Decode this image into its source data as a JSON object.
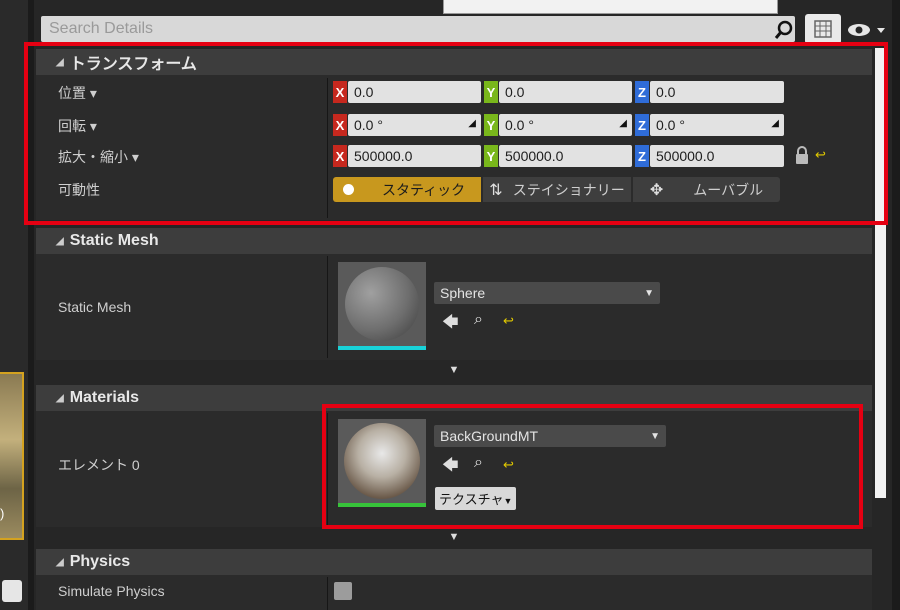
{
  "search": {
    "placeholder": "Search Details"
  },
  "sections": {
    "transform": {
      "title": "トランスフォーム"
    },
    "static_mesh": {
      "title": "Static Mesh"
    },
    "materials": {
      "title": "Materials"
    },
    "physics": {
      "title": "Physics"
    }
  },
  "transform": {
    "location": {
      "label": "位置",
      "x": "0.0",
      "y": "0.0",
      "z": "0.0"
    },
    "rotation": {
      "label": "回転",
      "x": "0.0 °",
      "y": "0.0 °",
      "z": "0.0 °"
    },
    "scale": {
      "label": "拡大・縮小",
      "x": "500000.0",
      "y": "500000.0",
      "z": "500000.0"
    },
    "mobility": {
      "label": "可動性",
      "options": [
        "スタティック",
        "ステイショナリー",
        "ムーバブル"
      ],
      "selected": "スタティック"
    },
    "axis_letters": {
      "x": "X",
      "y": "Y",
      "z": "Z"
    }
  },
  "static_mesh": {
    "label": "Static Mesh",
    "asset": "Sphere"
  },
  "materials": {
    "label": "エレメント 0",
    "asset": "BackGroundMT",
    "texture_button": "テクスチャ"
  },
  "physics": {
    "simulate_label": "Simulate Physics"
  },
  "left_strip": {
    "label_fragment": ")"
  },
  "colors": {
    "highlight_red": "#e60012",
    "mobility_selected": "#c8981e",
    "axis_x": "#c6281e",
    "axis_y": "#79b71b",
    "axis_z": "#2f6cd8"
  }
}
